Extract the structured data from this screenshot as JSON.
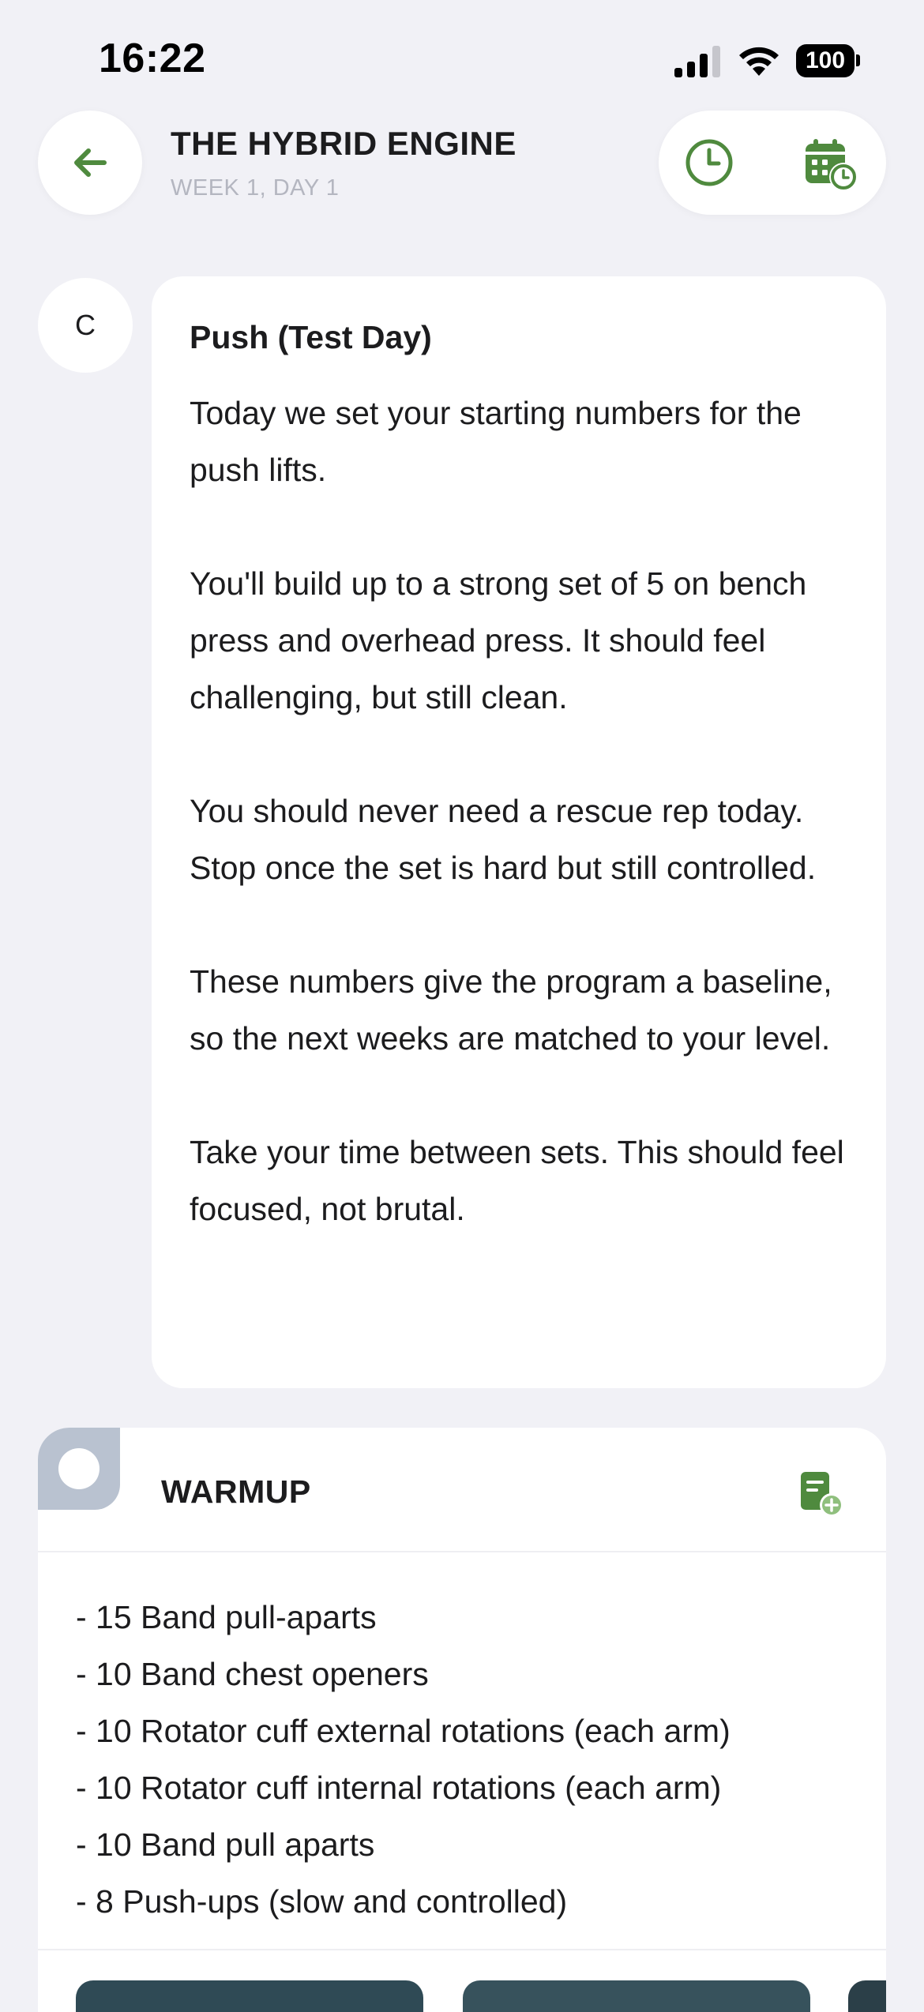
{
  "status_bar": {
    "time": "16:22",
    "battery": "100",
    "icons": [
      "cellular-signal-icon",
      "wifi-icon",
      "battery-icon"
    ]
  },
  "header": {
    "back_icon": "arrow-left-icon",
    "title": "THE HYBRID ENGINE",
    "subtitle": "WEEK 1, DAY 1",
    "history_icon": "clock-icon",
    "schedule_icon": "calendar-clock-icon"
  },
  "coach_message": {
    "avatar_initial": "C",
    "title": "Push (Test Day)",
    "paragraphs": [
      "Today we set your starting numbers for the push lifts.",
      "You'll build up to a strong set of 5 on bench press and overhead press. It should feel challenging, but still clean.",
      "You should never need a rescue rep today. Stop once the set is hard but still controlled.",
      "These numbers give the program a baseline, so the next weeks are matched to your level.",
      "Take your time between sets. This should feel focused, not brutal."
    ]
  },
  "warmup": {
    "title": "WARMUP",
    "add_note_icon": "note-add-icon",
    "items": [
      "- 15 Band pull-aparts",
      "- 10 Band chest openers",
      "- 10 Rotator cuff external rotations (each arm)",
      "- 10 Rotator cuff internal rotations (each arm)",
      "- 10 Band pull aparts",
      "- 8 Push-ups (slow and controlled)"
    ]
  },
  "colors": {
    "background": "#f1f1f6",
    "accent_green": "#4f8a3e",
    "card": "#ffffff",
    "warmup_marker": "#b9c2d0",
    "subtitle_gray": "#b4b6c0"
  }
}
